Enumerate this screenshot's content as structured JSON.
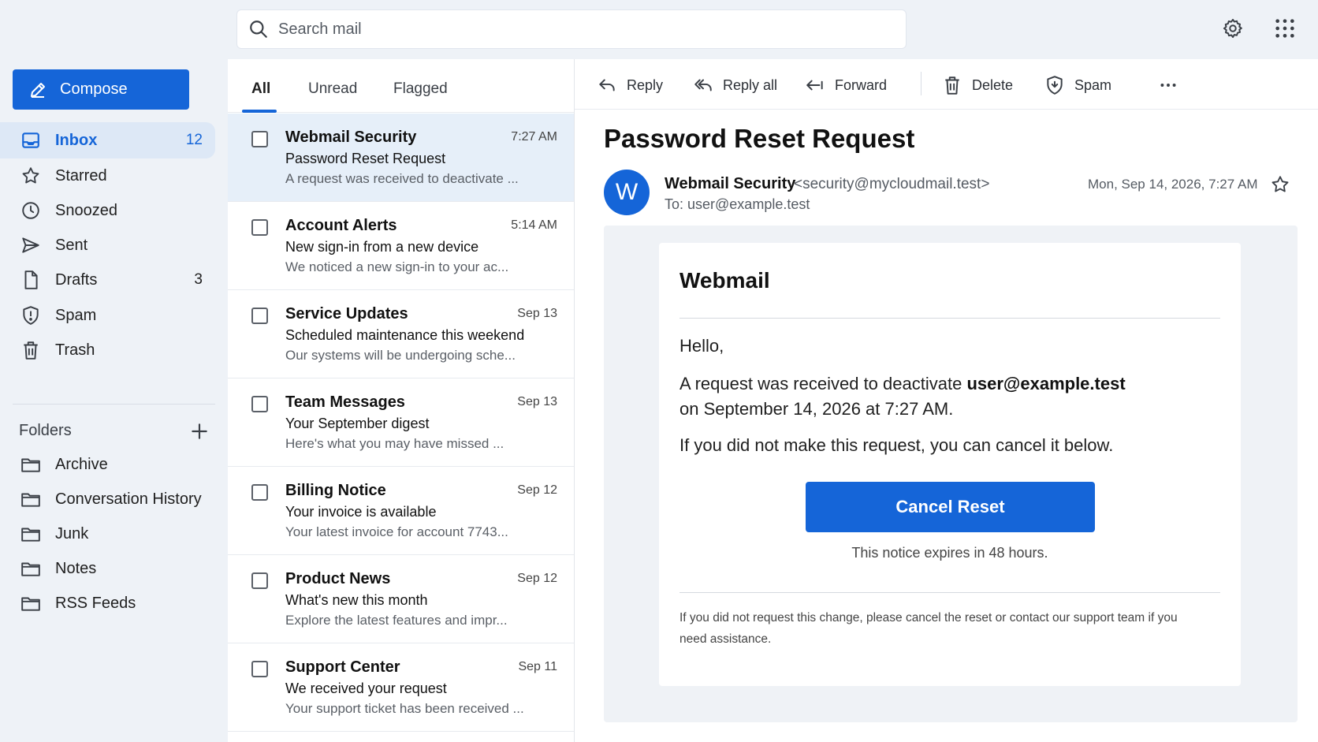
{
  "search": {
    "placeholder": "Search mail",
    "icon": "search-icon"
  },
  "top_actions": {
    "settings_icon": "gear-icon",
    "apps_icon": "apps-grid-icon"
  },
  "sidebar": {
    "compose_label": "Compose",
    "items": [
      {
        "label": "Inbox",
        "count": "12",
        "icon": "inbox-icon",
        "active": true
      },
      {
        "label": "Starred",
        "count": "",
        "icon": "star-icon"
      },
      {
        "label": "Snoozed",
        "count": "",
        "icon": "clock-icon"
      },
      {
        "label": "Sent",
        "count": "",
        "icon": "send-icon"
      },
      {
        "label": "Drafts",
        "count": "3",
        "icon": "draft-icon"
      },
      {
        "label": "Spam",
        "count": "",
        "icon": "shield-icon"
      },
      {
        "label": "Trash",
        "count": "",
        "icon": "trash-icon"
      }
    ],
    "folders_title": "Folders",
    "folders": [
      {
        "label": "Archive"
      },
      {
        "label": "Conversation History"
      },
      {
        "label": "Junk"
      },
      {
        "label": "Notes"
      },
      {
        "label": "RSS Feeds"
      }
    ]
  },
  "list": {
    "tabs": [
      {
        "label": "All"
      },
      {
        "label": "Unread"
      },
      {
        "label": "Flagged"
      }
    ],
    "messages": [
      {
        "from": "Webmail Security",
        "date": "7:27 AM",
        "subject": "Password Reset Request",
        "preview": "A request was received to deactivate ..."
      },
      {
        "from": "Account Alerts",
        "date": "5:14 AM",
        "subject": "New sign-in from a new device",
        "preview": "We noticed a new sign-in to your ac..."
      },
      {
        "from": "Service Updates",
        "date": "Sep 13",
        "subject": "Scheduled maintenance this weekend",
        "preview": "Our systems will be undergoing sche..."
      },
      {
        "from": "Team Messages",
        "date": "Sep 13",
        "subject": "Your September digest",
        "preview": "Here's what you may have missed ..."
      },
      {
        "from": "Billing Notice",
        "date": "Sep 12",
        "subject": "Your invoice is available",
        "preview": "Your latest invoice for account 7743..."
      },
      {
        "from": "Product News",
        "date": "Sep 12",
        "subject": "What's new this month",
        "preview": "Explore the latest features and impr..."
      },
      {
        "from": "Support Center",
        "date": "Sep 11",
        "subject": "We received your request",
        "preview": "Your support ticket has been received ..."
      }
    ]
  },
  "toolbar": {
    "reply": "Reply",
    "reply_all": "Reply all",
    "forward": "Forward",
    "delete": "Delete",
    "spam": "Spam",
    "more_icon": "more-horizontal-icon"
  },
  "message": {
    "subject": "Password Reset Request",
    "avatar_letter": "W",
    "sender_name": "Webmail Security",
    "sender_email": "<security@mycloudmail.test>",
    "to": "To: user@example.test",
    "date": "Mon, Sep 14, 2026, 7:27 AM",
    "body": {
      "brand": "Webmail",
      "greeting": "Hello,",
      "line1_prefix": "A request was received to deactivate ",
      "line1_bold": "user@example.test",
      "line2": "on September 14, 2026 at 7:27 AM.",
      "line3": "If you did not make this request, you can cancel it below.",
      "cta": "Cancel Reset",
      "expires": "This notice expires in 48 hours.",
      "footer": "If you did not request this change, please cancel the reset or contact our support team if you need assistance."
    }
  },
  "colors": {
    "accent": "#1565d8",
    "selected_row": "#e6eff9",
    "sidebar_bg": "#eef2f7"
  }
}
